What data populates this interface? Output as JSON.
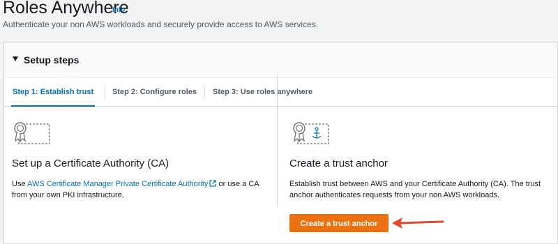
{
  "header": {
    "title": "Roles Anywhere",
    "info_label": "Info",
    "description": "Authenticate your non AWS workloads and securely provide access to AWS services."
  },
  "setup": {
    "title": "Setup steps",
    "tabs": [
      {
        "label": "Step 1: Establish trust",
        "active": true
      },
      {
        "label": "Step 2: Configure roles",
        "active": false
      },
      {
        "label": "Step 3: Use roles anywhere",
        "active": false
      }
    ]
  },
  "cards": {
    "ca": {
      "icon": "certificate-icon",
      "title": "Set up a Certificate Authority (CA)",
      "text_prefix": "Use ",
      "link_text": "AWS Certificate Manager Private Certificate Authority",
      "text_suffix": " or use a CA from your own PKI infrastructure."
    },
    "trust_anchor": {
      "icon": "trust-anchor-certificate-icon",
      "title": "Create a trust anchor",
      "text": "Establish trust between AWS and your Certificate Authority (CA). The trust anchor authenticates requests from your non AWS workloads.",
      "button_label": "Create a trust anchor"
    }
  },
  "colors": {
    "link": "#0073bb",
    "primary_button": "#ec7211",
    "annotation_arrow": "#e8462a"
  }
}
